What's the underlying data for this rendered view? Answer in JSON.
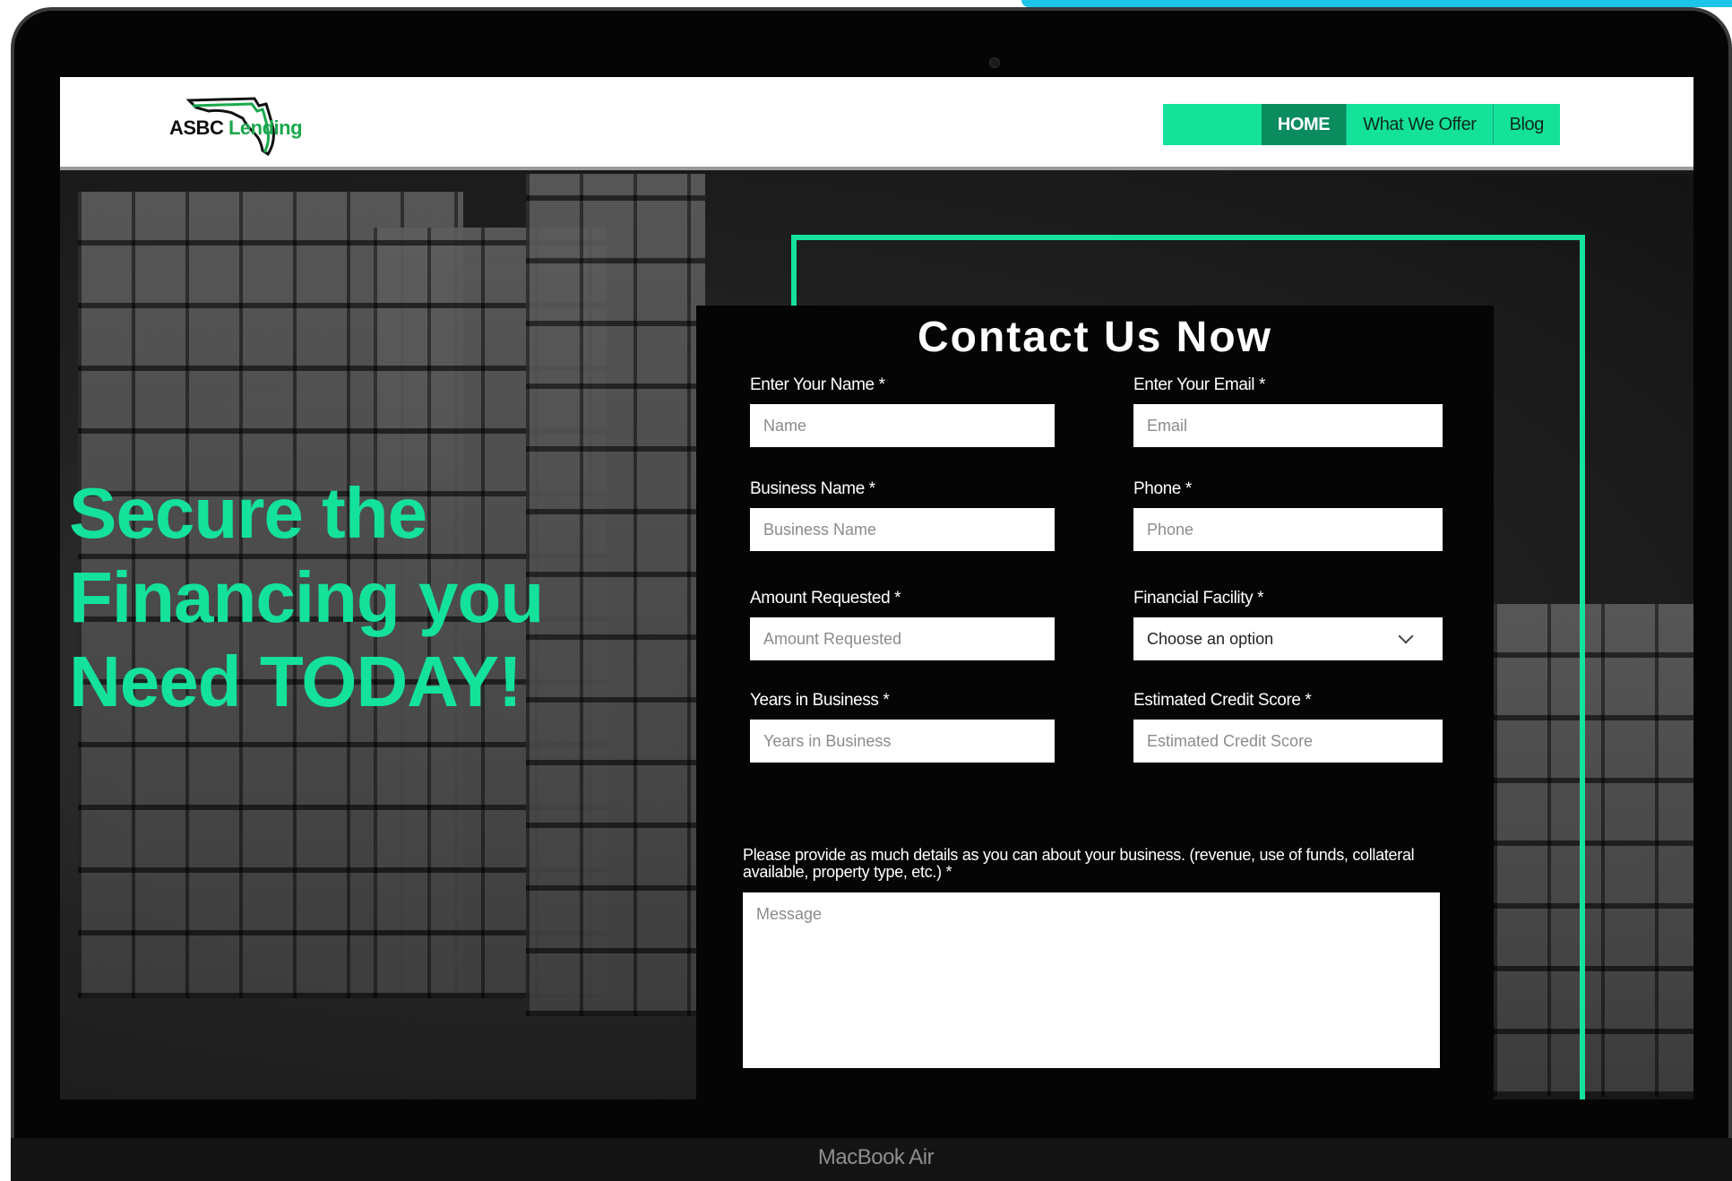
{
  "header": {
    "logo": {
      "text_primary": "ASBC",
      "text_secondary": "Lending",
      "colors": {
        "primary": "#111111",
        "secondary": "#1aa84c"
      }
    },
    "nav": [
      {
        "label": "HOME",
        "active": true
      },
      {
        "label": "What We Offer",
        "active": false
      },
      {
        "label": "Blog",
        "active": false
      }
    ]
  },
  "hero": {
    "title_lines": [
      "Secure the",
      "Financing you",
      "Need TODAY!"
    ]
  },
  "form": {
    "title": "Contact Us Now",
    "fields": {
      "name": {
        "label": "Enter Your Name *",
        "placeholder": "Name"
      },
      "email": {
        "label": "Enter Your Email *",
        "placeholder": "Email"
      },
      "business_name": {
        "label": "Business Name *",
        "placeholder": "Business Name"
      },
      "phone": {
        "label": "Phone *",
        "placeholder": "Phone"
      },
      "amount": {
        "label": "Amount Requested *",
        "placeholder": "Amount Requested"
      },
      "facility": {
        "label": "Financial Facility *",
        "value": "Choose an option"
      },
      "years": {
        "label": "Years in Business *",
        "placeholder": "Years in Business"
      },
      "credit": {
        "label": "Estimated Credit Score *",
        "placeholder": "Estimated Credit Score"
      }
    },
    "message": {
      "label": "Please provide as much details as you can about your business. (revenue, use of funds, collateral available, property type, etc.) *",
      "placeholder": "Message"
    }
  },
  "device": {
    "label": "MacBook Air"
  },
  "colors": {
    "accent": "#14e29a",
    "nav_active": "#0b8c5e",
    "corner_accent": "#1ec3e8",
    "form_bg": "#050505"
  }
}
